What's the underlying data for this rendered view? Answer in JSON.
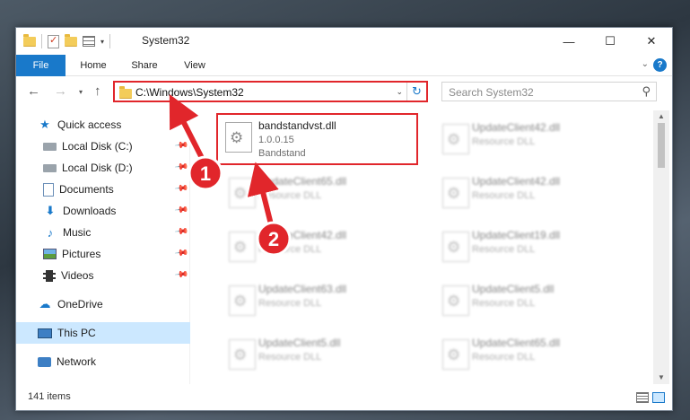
{
  "window": {
    "title": "System32",
    "controls": {
      "minimize": "—",
      "maximize": "☐",
      "close": "✕"
    }
  },
  "ribbon": {
    "tabs": [
      "File",
      "Home",
      "Share",
      "View"
    ],
    "expand_glyph": "⌄",
    "help_glyph": "?"
  },
  "nav": {
    "back_glyph": "←",
    "forward_glyph": "→",
    "recent_glyph": "▾",
    "up_glyph": "↑",
    "address": "C:\\Windows\\System32",
    "address_dropdown_glyph": "⌄",
    "refresh_glyph": "↻",
    "search_placeholder": "Search System32",
    "search_glyph": "⚲"
  },
  "sidebar": {
    "items": [
      {
        "label": "Quick access",
        "icon": "star-icon",
        "pinned": false
      },
      {
        "label": "Local Disk (C:)",
        "icon": "drive-icon",
        "pinned": true
      },
      {
        "label": "Local Disk (D:)",
        "icon": "drive-icon",
        "pinned": true
      },
      {
        "label": "Documents",
        "icon": "documents-icon",
        "pinned": true
      },
      {
        "label": "Downloads",
        "icon": "download-icon",
        "pinned": true
      },
      {
        "label": "Music",
        "icon": "music-icon",
        "pinned": true
      },
      {
        "label": "Pictures",
        "icon": "pictures-icon",
        "pinned": true
      },
      {
        "label": "Videos",
        "icon": "videos-icon",
        "pinned": true
      },
      {
        "label": "OneDrive",
        "icon": "cloud-icon",
        "pinned": false
      },
      {
        "label": "This PC",
        "icon": "computer-icon",
        "pinned": false,
        "selected": true
      },
      {
        "label": "Network",
        "icon": "network-icon",
        "pinned": false
      }
    ]
  },
  "files": {
    "highlighted": {
      "name": "bandstandvst.dll",
      "version": "1.0.0.15",
      "description": "Bandstand"
    },
    "left_column": [
      {
        "name": "UpdateClient65.dll",
        "description": "Resource DLL"
      },
      {
        "name": "UpdateClient42.dll",
        "description": "Resource DLL"
      },
      {
        "name": "UpdateClient63.dll",
        "description": "Resource DLL"
      },
      {
        "name": "UpdateClient5.dll",
        "description": "Resource DLL"
      }
    ],
    "right_column": [
      {
        "name": "UpdateClient42.dll",
        "description": "Resource DLL"
      },
      {
        "name": "UpdateClient42.dll",
        "description": "Resource DLL"
      },
      {
        "name": "UpdateClient19.dll",
        "description": "Resource DLL"
      },
      {
        "name": "UpdateClient5.dll",
        "description": "Resource DLL"
      },
      {
        "name": "UpdateClient65.dll",
        "description": "Resource DLL"
      }
    ]
  },
  "status": {
    "item_count": "141 items"
  },
  "annotations": {
    "step1": "1",
    "step2": "2"
  },
  "colors": {
    "accent": "#1979ca",
    "highlight_red": "#e1262b",
    "selected_bg": "#cce8ff"
  }
}
